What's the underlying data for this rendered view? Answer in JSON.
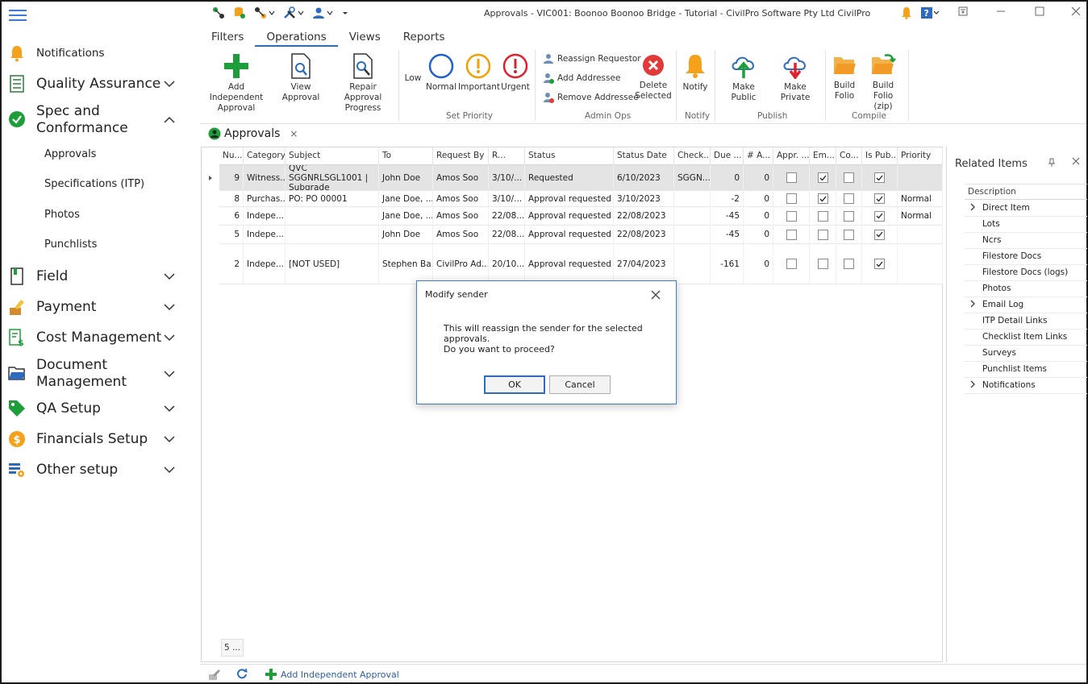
{
  "window": {
    "title": "Approvals - VIC001: Boonoo Boonoo Bridge - Tutorial - CivilPro Software Pty Ltd CivilPro"
  },
  "sidebar": {
    "items": [
      {
        "label": "Notifications",
        "icon": "bell-icon"
      },
      {
        "label": "Quality Assurance",
        "icon": "checklist-icon"
      },
      {
        "label": "Spec and Conformance",
        "icon": "check-circle-icon"
      },
      {
        "label": "Field",
        "icon": "book-icon"
      },
      {
        "label": "Payment",
        "icon": "pen-icon"
      },
      {
        "label": "Cost Management",
        "icon": "dollar-doc-icon"
      },
      {
        "label": "Document Management",
        "icon": "folder-icon"
      },
      {
        "label": "QA Setup",
        "icon": "tag-icon"
      },
      {
        "label": "Financials Setup",
        "icon": "coin-icon"
      },
      {
        "label": "Other setup",
        "icon": "settings-table-icon"
      }
    ],
    "spec_line1": "Spec and",
    "spec_line2": "Conformance",
    "doc_line1": "Document",
    "doc_line2": "Management",
    "sub_items": [
      "Approvals",
      "Specifications (ITP)",
      "Photos",
      "Punchlists"
    ]
  },
  "ribbon": {
    "tabs": [
      "Filters",
      "Operations",
      "Views",
      "Reports"
    ],
    "active_tab": "Operations",
    "buttons": {
      "add_independent_line1": "Add Independent",
      "add_independent_line2": "Approval",
      "view_approval": "View Approval",
      "repair_line1": "Repair Approval",
      "repair_line2": "Progress",
      "low": "Low",
      "normal": "Normal",
      "important": "Important",
      "urgent": "Urgent",
      "reassign_requestor": "Reassign Requestor",
      "add_addressee": "Add Addressee",
      "remove_addressee": "Remove Addressee",
      "delete_line1": "Delete",
      "delete_line2": "Selected",
      "notify": "Notify",
      "make_public": "Make Public",
      "make_private": "Make Private",
      "build_folio_line1": "Build",
      "build_folio_line2": "Folio",
      "build_folio_zip_line1": "Build Folio",
      "build_folio_zip_line2": "(zip)"
    },
    "groups": {
      "set_priority": "Set Priority",
      "admin_ops": "Admin Ops",
      "notify": "Notify",
      "publish": "Publish",
      "compile": "Compile"
    }
  },
  "document_tab": {
    "label": "Approvals",
    "close": "×"
  },
  "grid": {
    "columns": [
      "Nu...",
      "Category",
      "Subject",
      "To",
      "Request By",
      "R...",
      "Status",
      "Status Date",
      "Check...",
      "Due ...",
      "# A...",
      "Appr. ...",
      "Em...",
      "Co...",
      "Is Pub...",
      "Priority"
    ],
    "rows": [
      {
        "num": "9",
        "category": "Witness...",
        "subject": "QVC SGGNRLSGL1001 | Subgrade",
        "to": "John  Doe",
        "request_by": "Amos Soo",
        "r": "3/10/...",
        "status": "Requested",
        "status_date": "6/10/2023",
        "check": "SGGN...",
        "due": "0",
        "num_a": "0",
        "appr": false,
        "em": true,
        "co": false,
        "is_pub": true,
        "priority": ""
      },
      {
        "num": "8",
        "category": "Purchas...",
        "subject": "PO: PO 00001",
        "to": "Jane Doe, ...",
        "request_by": "Amos Soo",
        "r": "3/10/...",
        "status": "Approval requested",
        "status_date": "3/10/2023",
        "check": "",
        "due": "-2",
        "num_a": "0",
        "appr": false,
        "em": true,
        "co": false,
        "is_pub": true,
        "priority": "Normal"
      },
      {
        "num": "6",
        "category": "Indepe...",
        "subject": "",
        "to": "Jane Doe, ...",
        "request_by": "Amos Soo",
        "r": "22/08...",
        "status": "Approval requested",
        "status_date": "22/08/2023",
        "check": "",
        "due": "-45",
        "num_a": "0",
        "appr": false,
        "em": false,
        "co": false,
        "is_pub": true,
        "priority": "Normal"
      },
      {
        "num": "5",
        "category": "Indepe...",
        "subject": "",
        "to": "John  Doe",
        "request_by": "Amos Soo",
        "r": "22/08...",
        "status": "Approval requested",
        "status_date": "22/08/2023",
        "check": "",
        "due": "-45",
        "num_a": "0",
        "appr": false,
        "em": false,
        "co": false,
        "is_pub": true,
        "priority": ""
      },
      {
        "num": "2",
        "category": "Indepe...",
        "subject": "[NOT USED]",
        "to": "Stephen Ba...",
        "request_by": "CivilPro Ad...",
        "r": "20/10...",
        "status": "Approval requested",
        "status_date": "27/04/2023",
        "check": "",
        "due": "-161",
        "num_a": "0",
        "appr": false,
        "em": false,
        "co": false,
        "is_pub": true,
        "priority": ""
      }
    ],
    "footer_count": "5 ..."
  },
  "related": {
    "title": "Related Items",
    "header": "Description",
    "items": [
      {
        "label": "Direct Item",
        "expandable": true
      },
      {
        "label": "Lots",
        "expandable": false
      },
      {
        "label": "Ncrs",
        "expandable": false
      },
      {
        "label": "Filestore Docs",
        "expandable": false
      },
      {
        "label": "Filestore Docs (logs)",
        "expandable": false
      },
      {
        "label": "Photos",
        "expandable": false
      },
      {
        "label": "Email Log",
        "expandable": true
      },
      {
        "label": "ITP Detail Links",
        "expandable": false
      },
      {
        "label": "Checklist Item Links",
        "expandable": false
      },
      {
        "label": "Surveys",
        "expandable": false
      },
      {
        "label": "Punchlist Items",
        "expandable": false
      },
      {
        "label": "Notifications",
        "expandable": true
      }
    ]
  },
  "statusbar": {
    "add_independent": "Add Independent Approval"
  },
  "modal": {
    "title": "Modify sender",
    "message1": "This will reassign the sender for the selected approvals.",
    "message2": "Do you want to proceed?",
    "ok": "OK",
    "cancel": "Cancel"
  },
  "colors": {
    "accent": "#2e6bbd",
    "add_green": "#1e9e3a",
    "priority_blue": "#1f5fd1",
    "priority_orange": "#f0a000",
    "priority_red": "#e0202a",
    "delete_red": "#e23a3a",
    "bell_orange": "#f5a21a",
    "folder_orange": "#f29a26"
  }
}
